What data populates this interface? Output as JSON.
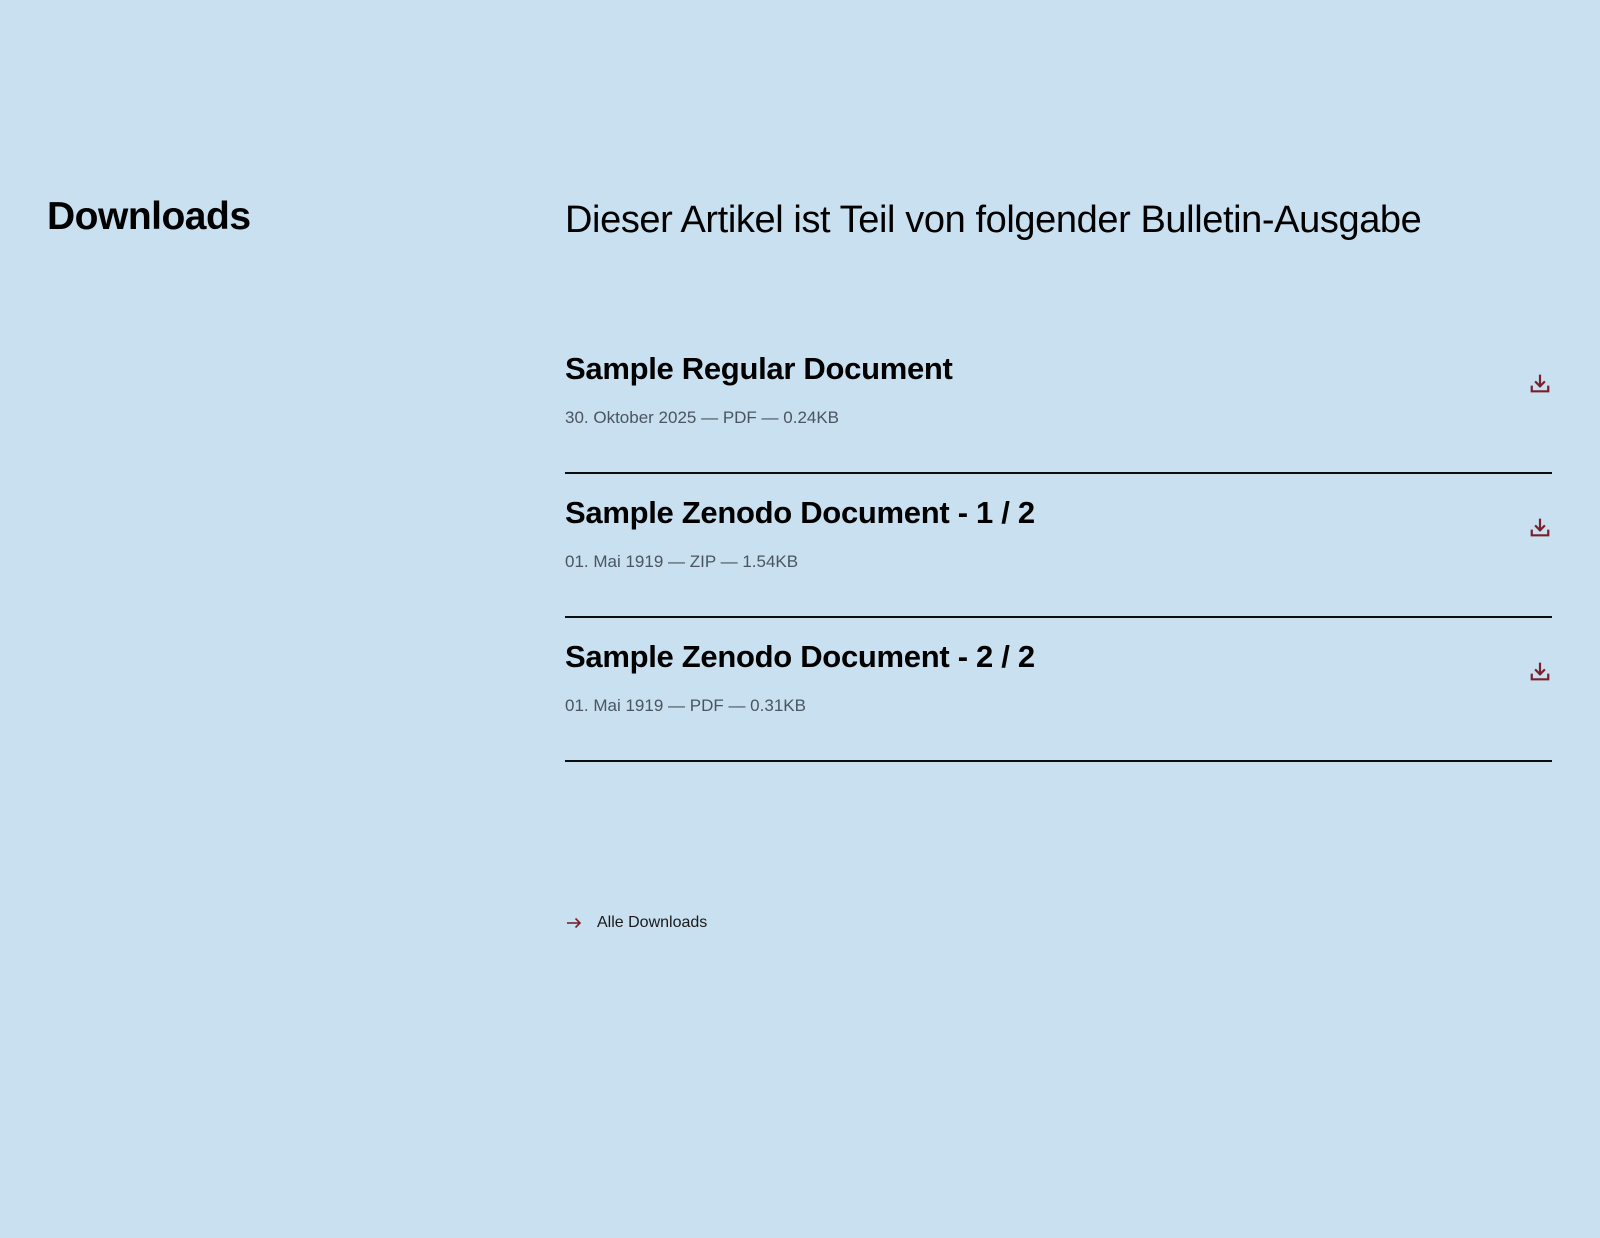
{
  "section": {
    "title": "Downloads"
  },
  "intro": {
    "text": "Dieser Artikel ist Teil von folgender Bulletin-Ausgabe"
  },
  "documents": [
    {
      "title": "Sample Regular Document",
      "meta": "30. Oktober 2025 — PDF — 0.24KB",
      "icon": "download-icon"
    },
    {
      "title": "Sample Zenodo Document - 1 / 2",
      "meta": "01. Mai 1919 — ZIP — 1.54KB",
      "icon": "download-icon"
    },
    {
      "title": "Sample Zenodo Document - 2 / 2",
      "meta": "01. Mai 1919 — PDF — 0.31KB",
      "icon": "download-icon"
    }
  ],
  "all_downloads": {
    "label": "Alle Downloads",
    "icon": "arrow-right-icon"
  },
  "colors": {
    "background": "#c8e0ef",
    "accent": "#7a1f2b",
    "divider": "#0d0d0d",
    "meta_text": "#4a5560"
  }
}
